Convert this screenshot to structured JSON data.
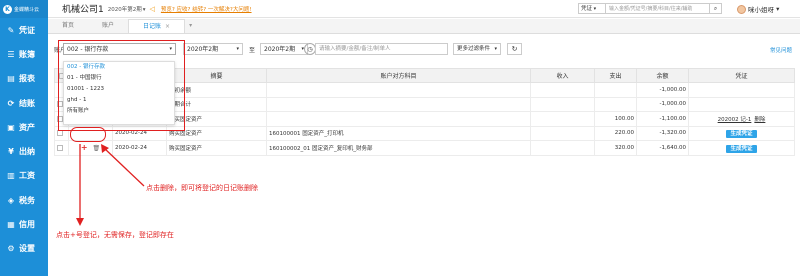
{
  "app": {
    "logo_text": "金蝶精斗云",
    "logo_mark": "K",
    "company": "机械公司1",
    "period": "2020年第2期",
    "alert_text": "预览? 应收? 结转? 一次解决?大问题!",
    "alert_icon": "bell-icon"
  },
  "sidebar": {
    "items": [
      {
        "label": "凭证",
        "icon": "✎"
      },
      {
        "label": "账簿",
        "icon": "☰"
      },
      {
        "label": "报表",
        "icon": "▤"
      },
      {
        "label": "结账",
        "icon": "⟳"
      },
      {
        "label": "资产",
        "icon": "▣"
      },
      {
        "label": "出纳",
        "icon": "¥"
      },
      {
        "label": "工资",
        "icon": "▥"
      },
      {
        "label": "税务",
        "icon": "◈"
      },
      {
        "label": "信用",
        "icon": "▦"
      },
      {
        "label": "设置",
        "icon": "⚙"
      }
    ]
  },
  "search": {
    "type": "凭证",
    "placeholder": "输入金额/凭证号/摘要/科目/往来/辅助",
    "button": "⌕"
  },
  "user": {
    "name": "咪小姐呀"
  },
  "tabs": {
    "items": [
      {
        "label": "首页"
      },
      {
        "label": "账户"
      },
      {
        "label": "日记账",
        "close": "×"
      }
    ],
    "more": "▾"
  },
  "filters": {
    "account_label": "账户",
    "account_value": "002 - 银行存款",
    "date_from": "2020年2期",
    "to_label": "至",
    "date_to": "2020年2期",
    "keyword_placeholder": "请输入摘要/金额/备注/制单人",
    "more_label": "更多过滤条件",
    "help_label": "常见问题",
    "refresh_icon": "↻",
    "arrow": "▾",
    "clock_icon": "◷"
  },
  "dropdown": {
    "options": [
      "002 - 银行存款",
      "01 - 中国银行",
      "01001 - 1223",
      "ghd - 1",
      "所有账户"
    ]
  },
  "table": {
    "headers": [
      "",
      "",
      "日期",
      "摘要",
      "账户对方科目",
      "收入",
      "支出",
      "余额",
      "凭证"
    ],
    "rows": [
      {
        "summary": "期初余额",
        "balance": "-1,000.00"
      },
      {
        "summary": "本期合计",
        "balance": "-1,000.00"
      },
      {
        "date": "2020-02-24",
        "summary": "购买固定资产",
        "expense": "100.00",
        "balance": "-1,100.00",
        "voucher": "202002 记-1",
        "delete": "删除"
      },
      {
        "date": "2020-02-24",
        "summary": "购买固定资产",
        "account": "160100001 固定资产_打印机",
        "expense": "220.00",
        "balance": "-1,320.00",
        "gen": "生成凭证"
      },
      {
        "date": "2020-02-24",
        "summary": "购买固定资产",
        "account": "160100002_01 固定资产_复印机_财务部",
        "expense": "320.00",
        "balance": "-1,640.00",
        "gen": "生成凭证",
        "plus": "+",
        "trash": "🗑"
      }
    ]
  },
  "notes": {
    "delete_note": "点击删除，即可将登记的日记账删除",
    "add_note": "点击+号登记，无需保存，登记即存在"
  },
  "colors": {
    "brand": "#1d8fd8",
    "annotation": "#e02020"
  }
}
